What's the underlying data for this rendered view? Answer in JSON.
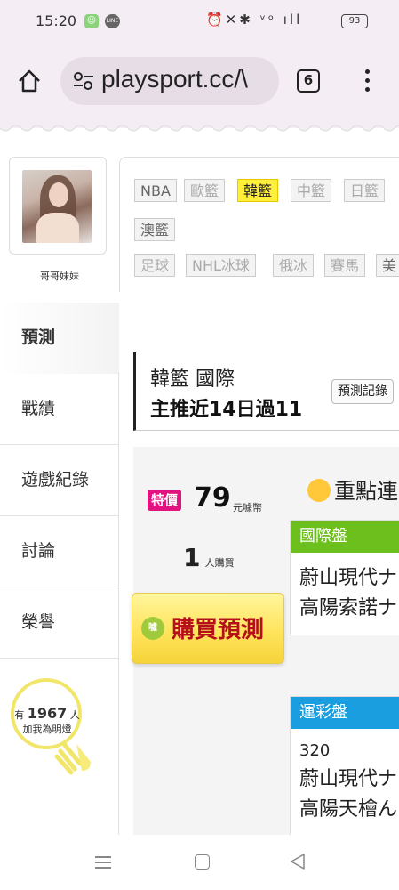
{
  "status_bar": {
    "time": "15:20",
    "right_icons": [
      "alarm-icon",
      "mute-icon",
      "bluetooth-icon",
      "volte-icon",
      "4g-signal-icon"
    ],
    "battery": "93"
  },
  "browser": {
    "url": "playsport.cc/\\",
    "tab_count": "6"
  },
  "profile": {
    "name": "哥哥妹妹"
  },
  "filters": {
    "row1": [
      {
        "label": "NBA",
        "state": "normal"
      },
      {
        "label": "歐籃",
        "state": "dim"
      },
      {
        "label": "韓籃",
        "state": "active"
      },
      {
        "label": "中籃",
        "state": "dim"
      },
      {
        "label": "日籃",
        "state": "dim"
      }
    ],
    "row2": [
      {
        "label": "澳籃",
        "state": "normal"
      }
    ],
    "row3": [
      {
        "label": "足球",
        "state": "dim"
      },
      {
        "label": "NHL冰球",
        "state": "dim"
      },
      {
        "label": "俄冰",
        "state": "dim"
      },
      {
        "label": "賽馬",
        "state": "dim"
      },
      {
        "label": "美",
        "state": "normal"
      }
    ]
  },
  "sidenav": {
    "items": [
      {
        "label": "預測",
        "active": true
      },
      {
        "label": "戰績",
        "active": false
      },
      {
        "label": "遊戲紀錄",
        "active": false
      },
      {
        "label": "討論",
        "active": false
      },
      {
        "label": "榮譽",
        "active": false
      }
    ]
  },
  "lamp": {
    "prefix": "有",
    "count": "1967",
    "suffix": "人",
    "caption": "加我為明燈"
  },
  "prediction": {
    "title": "韓籃 國際",
    "subtitle": "主推近14日過11",
    "record_button": "預測記錄"
  },
  "offer": {
    "badge": "特價",
    "price": "79",
    "unit": "元噱幣",
    "buyers": "1",
    "buyers_unit": "人購買",
    "buy_icon_text": "噱",
    "buy_button": "購買預測",
    "key_title": "重點連"
  },
  "markets": [
    {
      "header": "國際盤",
      "color": "#6dbf1e",
      "lines": [
        "蔚山現代ナ",
        "高陽索諾ナ"
      ]
    },
    {
      "header": "運彩盤",
      "color": "#1a9ee0",
      "number": "320",
      "lines": [
        "蔚山現代ナ",
        "高陽天檜ん"
      ]
    }
  ]
}
